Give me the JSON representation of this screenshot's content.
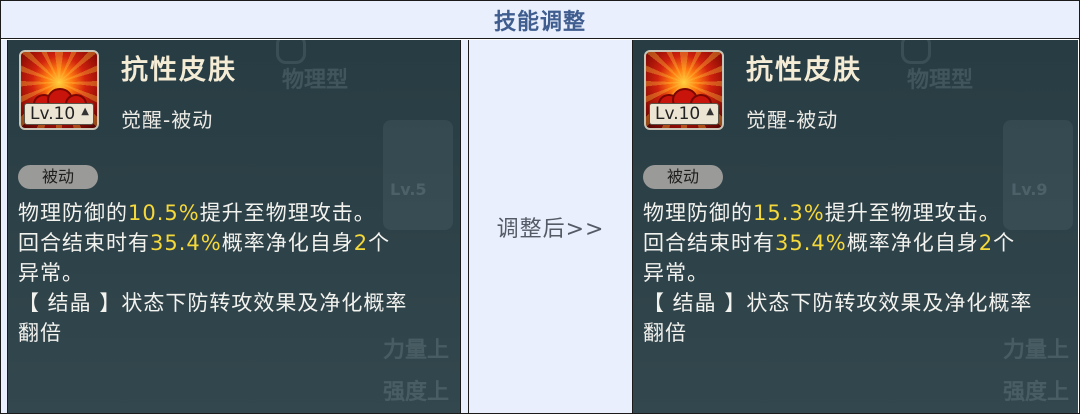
{
  "header": {
    "title": "技能调整"
  },
  "middle": {
    "label": "调整后>>"
  },
  "colors": {
    "highlight": "#f5d83a",
    "header_bg": "#e9effc",
    "title": "#3f5d8f",
    "panel_bg": "#2c4047"
  },
  "before": {
    "skill_name": "抗性皮肤",
    "level": "Lv.10",
    "skill_type": "觉醒-被动",
    "tag": "被动",
    "line1_a": "物理防御的",
    "line1_value": "10.5%",
    "line1_b": "提升至物理攻击。",
    "line2_a": "回合结束时有",
    "line2_value": "35.4%",
    "line2_b": "概率净化自身",
    "line2_count": "2",
    "line2_c": "个",
    "line3": "异常。",
    "line4": "【 结晶 】状态下防转攻效果及净化概率",
    "line5": "翻倍",
    "ghost_top": "物理型",
    "ghost_lv": "Lv.5",
    "ghost_1": "力量上",
    "ghost_2": "强度上"
  },
  "after": {
    "skill_name": "抗性皮肤",
    "level": "Lv.10",
    "skill_type": "觉醒-被动",
    "tag": "被动",
    "line1_a": "物理防御的",
    "line1_value": "15.3%",
    "line1_b": "提升至物理攻击。",
    "line2_a": "回合结束时有",
    "line2_value": "35.4%",
    "line2_b": "概率净化自身",
    "line2_count": "2",
    "line2_c": "个",
    "line3": "异常。",
    "line4": "【 结晶 】状态下防转攻效果及净化概率",
    "line5": "翻倍",
    "ghost_top": "物理型",
    "ghost_lv": "Lv.9",
    "ghost_1": "力量上",
    "ghost_2": "强度上"
  }
}
